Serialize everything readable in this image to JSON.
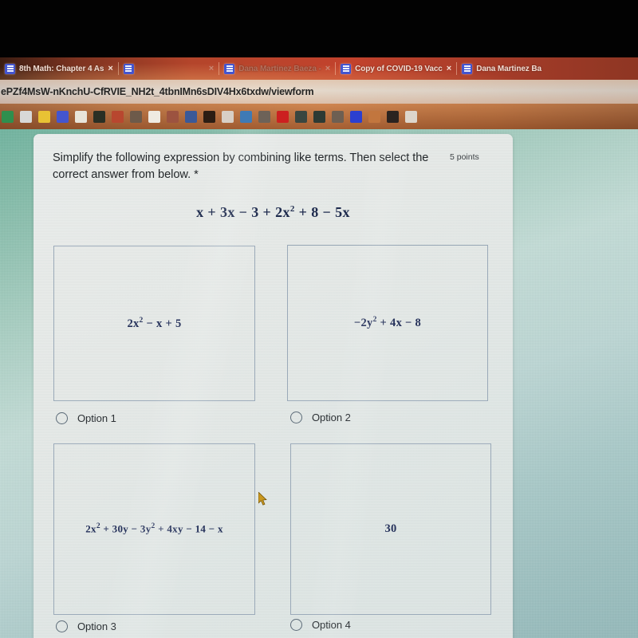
{
  "browser": {
    "tabs": [
      {
        "title": "8th Math: Chapter 4 As",
        "favicon": "google-forms-icon",
        "close": "×",
        "active": true
      },
      {
        "title": "",
        "favicon": "google-forms-icon",
        "close": "×",
        "active": false
      },
      {
        "title": "Dana Martinez Baeza -",
        "favicon": "google-forms-icon",
        "close": "×",
        "active": false
      },
      {
        "title": "Copy of COVID-19 Vacc",
        "favicon": "google-forms-icon",
        "close": "×",
        "active": false
      },
      {
        "title": "Dana Martinez Ba",
        "favicon": "google-forms-icon",
        "close": "×",
        "active": false
      }
    ],
    "url": "ePZf4MsW-nKnchU-CfRVIE_NH2t_4tbnIMn6sDIV4Hx6txdw/viewform",
    "bookmarks": [
      {
        "name": "classroom-bookmark",
        "color": "#2f8f4e"
      },
      {
        "name": "contacts-bookmark",
        "color": "#d8d8d8"
      },
      {
        "name": "drive-bookmark",
        "color": "#e8c234"
      },
      {
        "name": "forms-bookmark",
        "color": "#4455cf"
      },
      {
        "name": "slides-bookmark",
        "color": "#e8e4da"
      },
      {
        "name": "church-bookmark",
        "color": "#2a2f24"
      },
      {
        "name": "keep-bookmark",
        "color": "#b8472f"
      },
      {
        "name": "sheets-bookmark",
        "color": "#6d5a4a"
      },
      {
        "name": "chrome-bookmark",
        "color": "#efeae2"
      },
      {
        "name": "library-bookmark",
        "color": "#9c5340"
      },
      {
        "name": "facebook-bookmark",
        "color": "#3b5998"
      },
      {
        "name": "amazon-bookmark",
        "color": "#2c1d13"
      },
      {
        "name": "pinterest-bookmark",
        "color": "#d8cfc6"
      },
      {
        "name": "globe-bookmark",
        "color": "#3f7ab5"
      },
      {
        "name": "shield-bookmark",
        "color": "#6d6258"
      },
      {
        "name": "youtube-bookmark",
        "color": "#cc2020"
      },
      {
        "name": "maps-pin-bookmark",
        "color": "#3a4640"
      },
      {
        "name": "location-bookmark",
        "color": "#2d3a34"
      },
      {
        "name": "spiral-bookmark",
        "color": "#6e5f52"
      },
      {
        "name": "blue-app-bookmark",
        "color": "#2b3fd0"
      },
      {
        "name": "star-bookmark",
        "color": "#c2763e"
      },
      {
        "name": "acorn-bookmark",
        "color": "#2b2320"
      },
      {
        "name": "window-bookmark",
        "color": "#ddd6cc"
      }
    ]
  },
  "form": {
    "question": "Simplify the following expression by combining like terms. Then select the correct answer from below. *",
    "points": "5 points",
    "expression": {
      "parts": [
        {
          "t": "x + 3x − 3 + 2x"
        },
        {
          "sup": "2"
        },
        {
          "t": " + 8 − 5x"
        }
      ],
      "plain": "x + 3x − 3 + 2x² + 8 − 5x"
    },
    "choices": [
      {
        "id": "option-1",
        "label": "Option 1",
        "image_math_plain": "2x² − x + 5",
        "image_math_pre": "2x",
        "image_math_sup": "2",
        "image_math_post": " − x + 5",
        "selected": false
      },
      {
        "id": "option-2",
        "label": "Option 2",
        "image_math_plain": "−2y² + 4x − 8",
        "image_math_pre": "−2y",
        "image_math_sup": "2",
        "image_math_post": " + 4x − 8",
        "selected": false
      },
      {
        "id": "option-3",
        "label": "Option 3",
        "image_math_plain": "2x² + 30y − 3y² + 4xy − 14 − x",
        "image_math_pre": "2x",
        "image_math_sup": "2",
        "image_math_mid": " + 30y − 3y",
        "image_math_sup2": "2",
        "image_math_post": " + 4xy − 14 − x",
        "selected": false
      },
      {
        "id": "option-4",
        "label": "Option 4",
        "image_math_plain": "30",
        "selected": false
      }
    ]
  },
  "colors": {
    "page_background_top": "#6fb39e",
    "page_background_bottom": "#94b9ba",
    "card_background": "#e7eae8",
    "math_text": "#26325b",
    "question_text": "#24282b",
    "choice_border": "#9aa9b8",
    "tabstrip": "#c2422c",
    "bookmarks_bar": "#c97a44"
  }
}
